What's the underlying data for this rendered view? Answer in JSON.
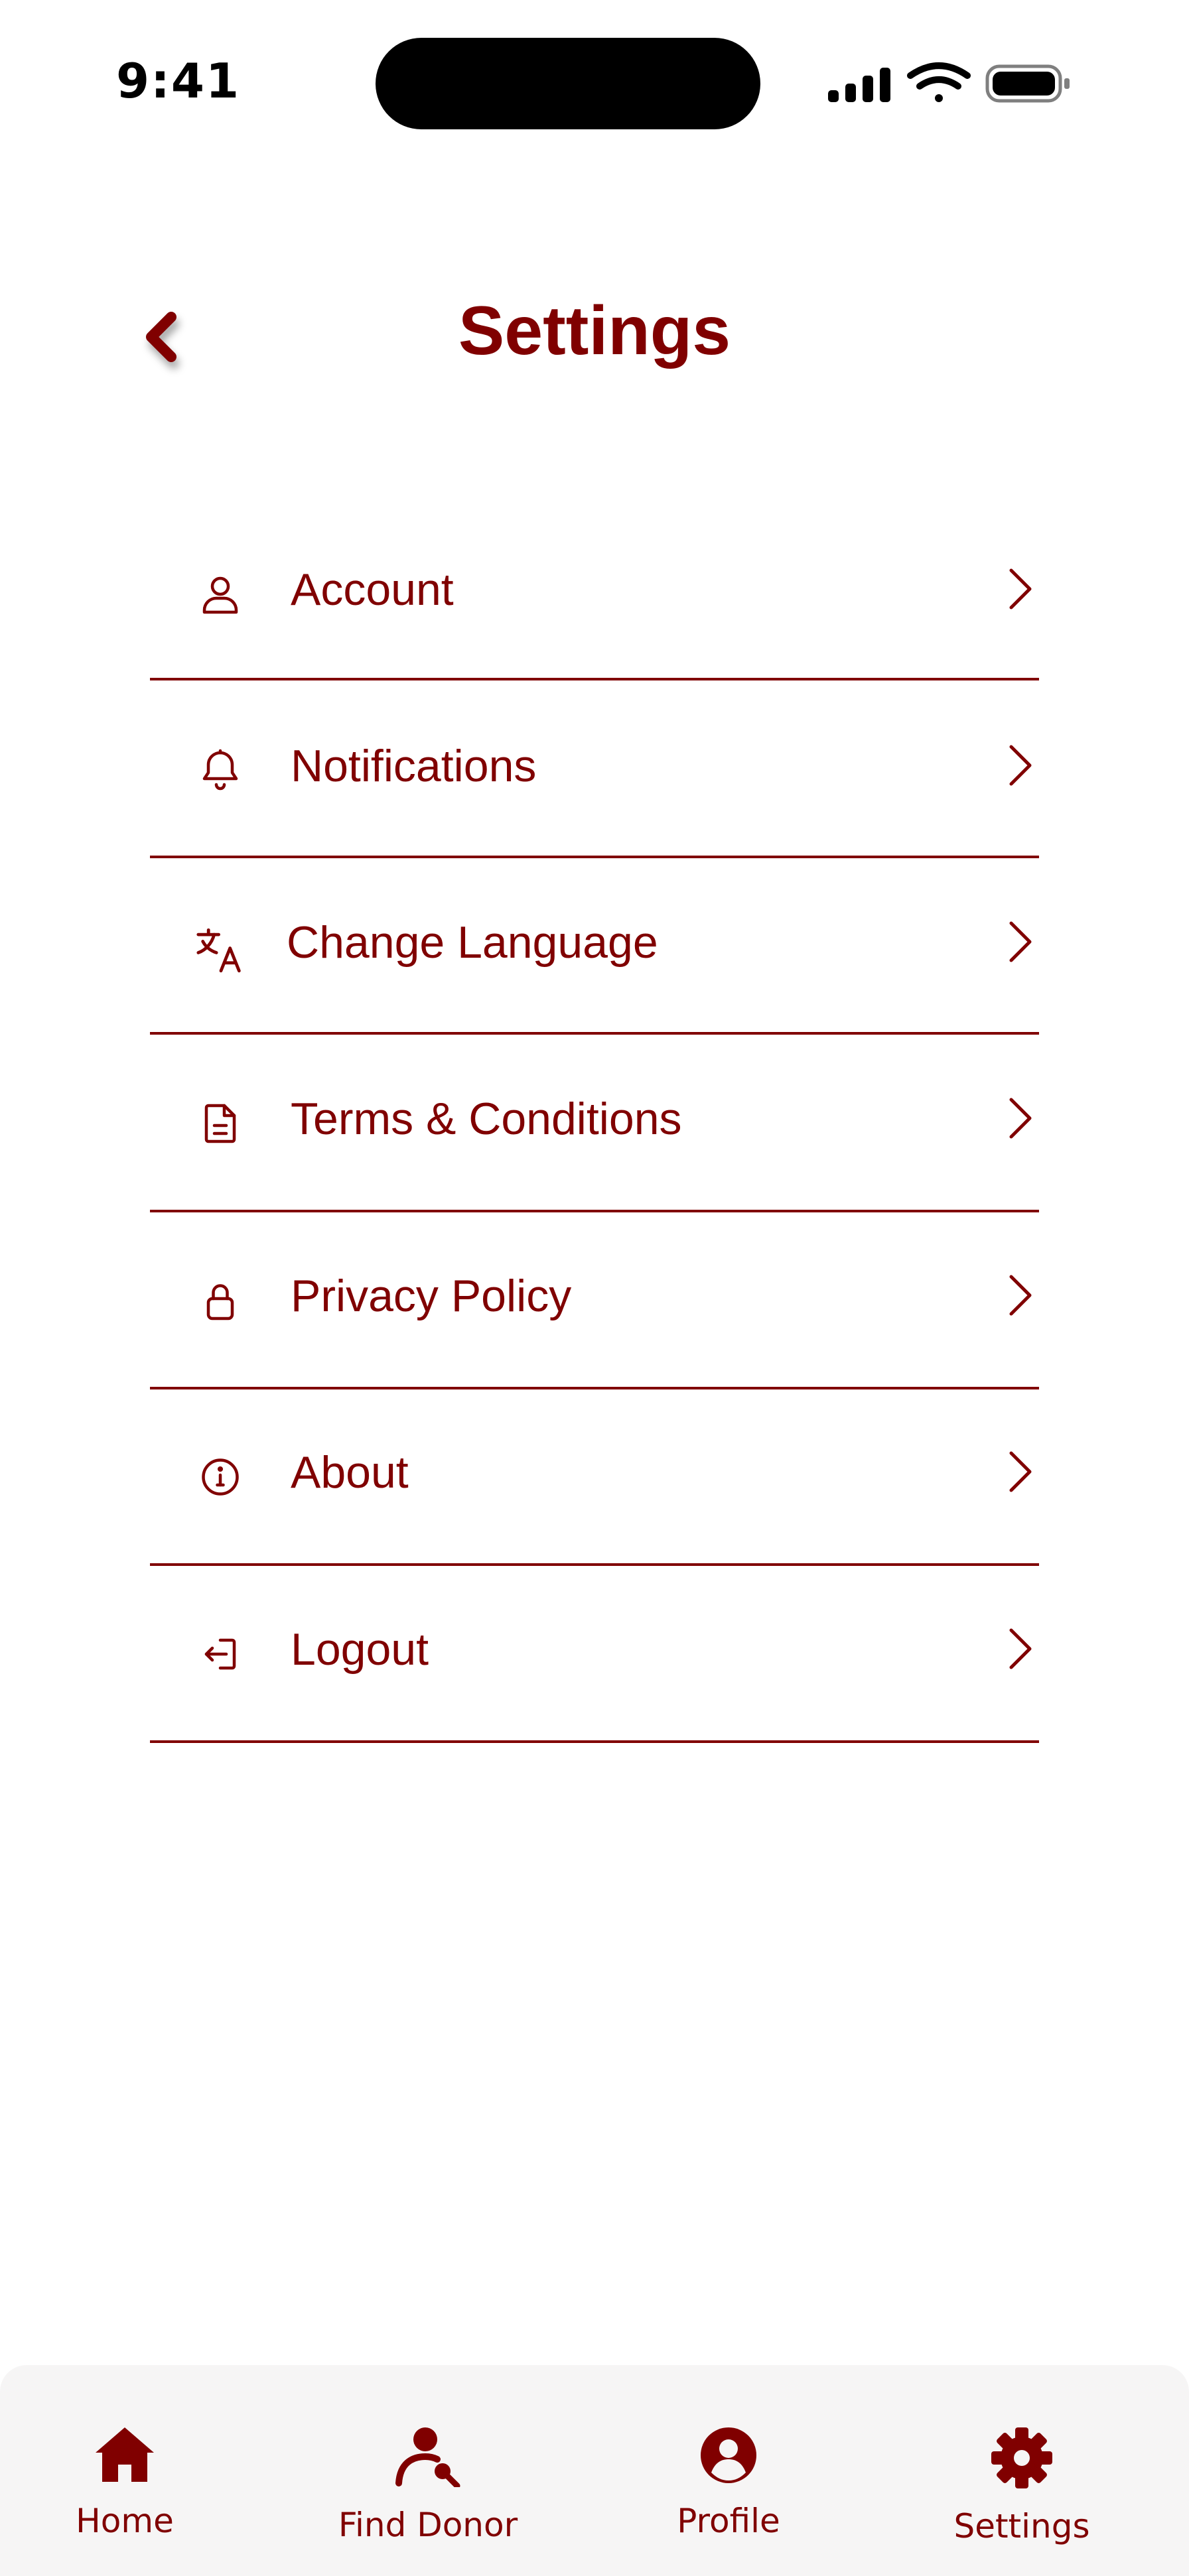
{
  "status_bar": {
    "time": "9:41"
  },
  "header": {
    "title": "Settings",
    "back_icon": "chevron-left-icon"
  },
  "accent_color": "#800000",
  "settings": {
    "items": [
      {
        "label": "Account",
        "icon": "user-icon"
      },
      {
        "label": "Notifications",
        "icon": "bell-icon"
      },
      {
        "label": "Change Language",
        "icon": "translate-icon"
      },
      {
        "label": "Terms & Conditions",
        "icon": "document-icon"
      },
      {
        "label": "Privacy Policy",
        "icon": "lock-icon"
      },
      {
        "label": "About",
        "icon": "info-icon"
      },
      {
        "label": "Logout",
        "icon": "logout-icon"
      }
    ]
  },
  "bottom_nav": {
    "items": [
      {
        "label": "Home",
        "icon": "home-icon"
      },
      {
        "label": "Find Donor",
        "icon": "find-donor-icon"
      },
      {
        "label": "Profile",
        "icon": "profile-icon"
      },
      {
        "label": "Settings",
        "icon": "gear-icon"
      }
    ]
  }
}
